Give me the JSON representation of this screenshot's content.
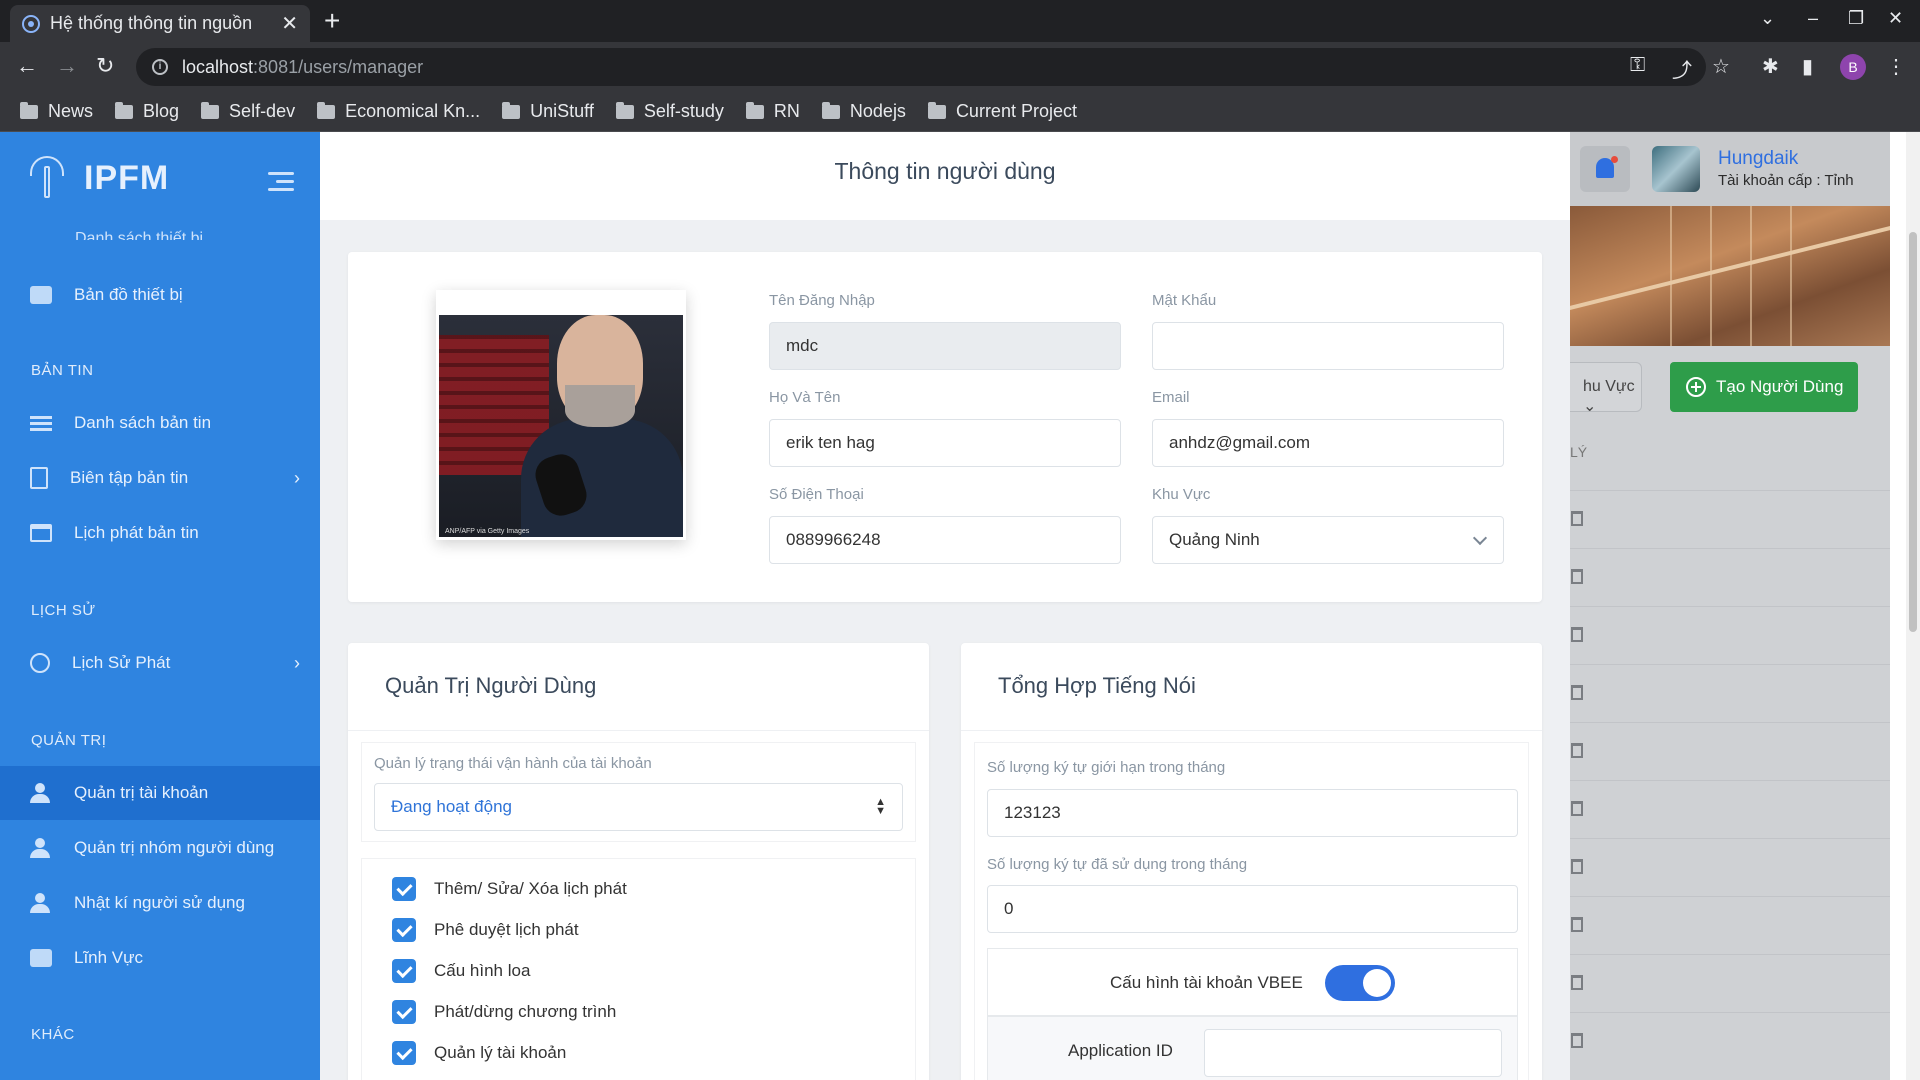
{
  "browser": {
    "tab_title": "Hệ thống thông tin nguồn",
    "url_host": "localhost",
    "url_rest": ":8081/users/manager",
    "profile_initial": "B",
    "bookmarks": [
      "News",
      "Blog",
      "Self-dev",
      "Economical Kn...",
      "UniStuff",
      "Self-study",
      "RN",
      "Nodejs",
      "Current Project"
    ]
  },
  "sidebar": {
    "brand": "IPFM",
    "cut_item": "Danh sách thiết bị",
    "map_item": "Bản đồ thiết bị",
    "sections": {
      "news": "BẢN TIN",
      "history": "LỊCH SỬ",
      "admin": "QUẢN TRỊ",
      "other": "KHÁC"
    },
    "news_items": [
      "Danh sách bản tin",
      "Biên tập bản tin",
      "Lịch phát bản tin"
    ],
    "history_items": [
      "Lịch Sử Phát"
    ],
    "admin_items": [
      "Quản trị tài khoản",
      "Quản trị nhóm người dùng",
      "Nhật kí người sử dụng",
      "Lĩnh Vực"
    ]
  },
  "page": {
    "title": "Thông tin người dùng"
  },
  "profile": {
    "photo_caption": "ANP/AFP via Getty Images",
    "username_label": "Tên Đăng Nhập",
    "username_value": "mdc",
    "password_label": "Mật Khẩu",
    "password_value": "",
    "fullname_label": "Họ Và Tên",
    "fullname_value": "erik ten hag",
    "email_label": "Email",
    "email_value": "anhdz@gmail.com",
    "phone_label": "Số Điện Thoại",
    "phone_value": "0889966248",
    "region_label": "Khu Vực",
    "region_value": "Quảng Ninh"
  },
  "user_admin": {
    "title": "Quản Trị Người Dùng",
    "status_label": "Quản lý trạng thái vận hành của tài khoản",
    "status_value": "Đang hoạt động",
    "permissions": [
      "Thêm/ Sửa/ Xóa lịch phát",
      "Phê duyệt lịch phát",
      "Cấu hình loa",
      "Phát/dừng chương trình",
      "Quản lý tài khoản"
    ]
  },
  "tts": {
    "title": "Tổng Hợp Tiếng Nói",
    "limit_label": "Số lượng ký tự giới hạn trong tháng",
    "limit_value": "123123",
    "used_label": "Số lượng ký tự đã sử dụng trong tháng",
    "used_value": "0",
    "vbee_label": "Cấu hình tài khoản VBEE",
    "vbee_enabled": true,
    "app_id_label": "Application ID",
    "app_id_value": ""
  },
  "background": {
    "user_name": "Hungdaik",
    "user_role": "Tài khoản cấp : Tỉnh",
    "region_filter": "hu Vực",
    "create_button": "Tạo Người Dùng",
    "column_header": "LÝ"
  },
  "colors": {
    "sidebar": "#2f84e0",
    "sidebar_active": "#1f6fcf",
    "accent": "#2f6fe0",
    "create_button": "#2e9d4a"
  }
}
